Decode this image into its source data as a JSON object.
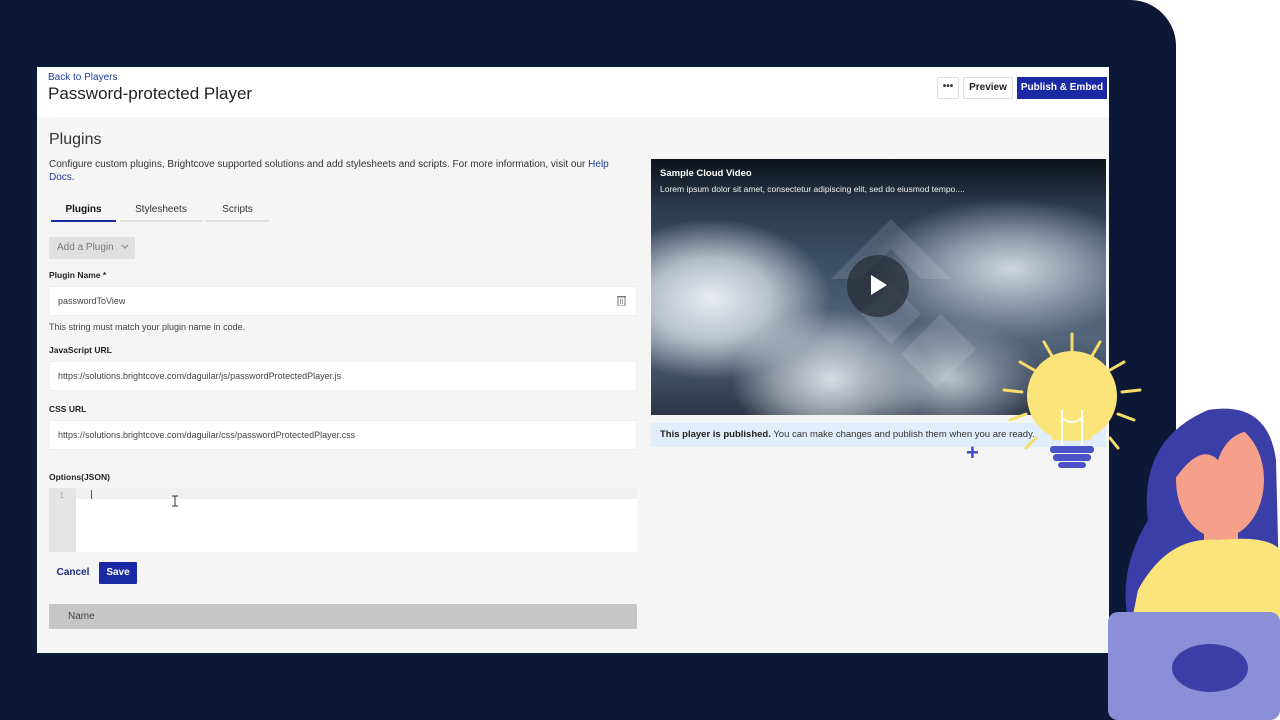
{
  "header": {
    "back_link": "Back to Players",
    "title": "Password-protected Player",
    "more_label": "•••",
    "preview_label": "Preview",
    "publish_label": "Publish & Embed"
  },
  "plugins": {
    "section_title": "Plugins",
    "description": "Configure custom plugins, Brightcove supported solutions and add stylesheets and scripts. For more information, visit our",
    "help_link": "Help Docs",
    "help_link_end": ".",
    "tabs": [
      {
        "label": "Plugins",
        "active": true
      },
      {
        "label": "Stylesheets",
        "active": false
      },
      {
        "label": "Scripts",
        "active": false
      }
    ],
    "add_plugin_label": "Add a Plugin",
    "plugin_name_label": "Plugin Name *",
    "plugin_name_value": "passwordToView",
    "plugin_name_help": "This string must match your plugin name in code.",
    "js_url_label": "JavaScript URL",
    "js_url_value": "https://solutions.brightcove.com/daguilar/js/passwordProtectedPlayer.js",
    "css_url_label": "CSS URL",
    "css_url_value": "https://solutions.brightcove.com/daguilar/css/passwordProtectedPlayer.css",
    "options_label": "Options(JSON)",
    "options_line_number": "1",
    "cancel_label": "Cancel",
    "save_label": "Save",
    "table_header_name": "Name"
  },
  "video": {
    "title": "Sample Cloud Video",
    "description": "Lorem ipsum dolor sit amet, consectetur adipiscing elit, sed do eiusmod tempo....",
    "status_bold": "This player is published.",
    "status_text": " You can make changes and publish them when you are ready."
  },
  "colors": {
    "brand_blue": "#1a2aa5",
    "backdrop": "#0d1836",
    "status_bg": "#dfeefa"
  },
  "icons": [
    "trash-icon",
    "chevron-down-icon",
    "play-icon",
    "lightbulb-icon"
  ]
}
